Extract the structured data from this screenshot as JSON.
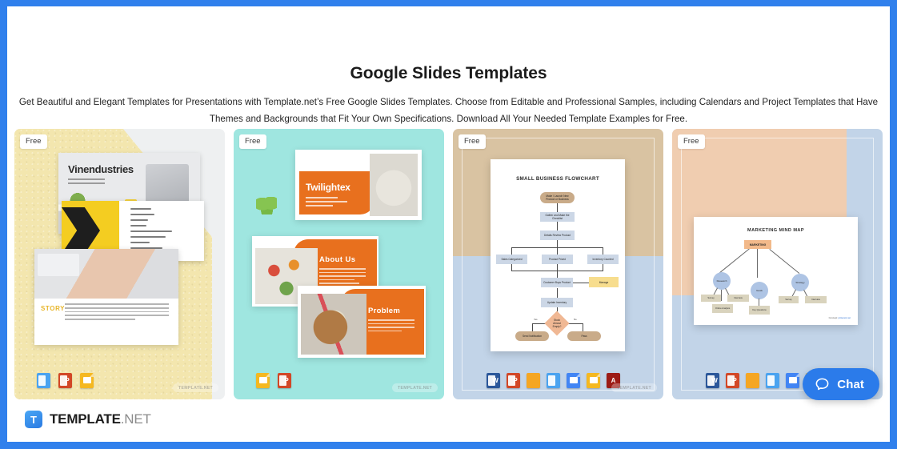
{
  "page": {
    "border_color": "#3080ec",
    "title": "Google Slides Templates",
    "subtitle": "Get Beautiful and Elegant Templates for Presentations with Template.net’s Free Google Slides Templates. Choose from Editable and Professional Samples, including Calendars and Project Templates that Have Themes and Backgrounds that Fit Your Own Specifications. Download All Your Needed Template Examples for Free."
  },
  "badges": {
    "free": "Free"
  },
  "watermark": "TEMPLATE.NET",
  "cards": [
    {
      "id": "vinendustries",
      "badge": "Free",
      "background": "#f3e6ae",
      "slide_title": "Vinendustries",
      "slide_story_label": "STORY",
      "formats": [
        "keynote",
        "powerpoint",
        "google-slides"
      ]
    },
    {
      "id": "twilightex",
      "badge": "Free",
      "background": "#9fe6e0",
      "slide_title": "Twilightex",
      "slide_about_title": "About Us",
      "slide_problem_title": "Problem",
      "formats": [
        "google-slides",
        "powerpoint"
      ]
    },
    {
      "id": "small-business-flowchart",
      "badge": "Free",
      "background_top": "#d9c3a2",
      "background_bottom": "#c2d4e8",
      "doc_title": "SMALL BUSINESS FLOWCHART",
      "formats": [
        "word",
        "powerpoint",
        "pages",
        "keynote",
        "google-docs",
        "google-slides",
        "pdf"
      ],
      "flowchart": {
        "nodes": [
          {
            "text": "Make / Launch New Product or Business",
            "type": "terminator"
          },
          {
            "text": "Gather and Make the Checklist",
            "type": "process"
          },
          {
            "text": "Details Review Product",
            "type": "process"
          },
          {
            "text": "Sales Categorized",
            "type": "process"
          },
          {
            "text": "Product Priced",
            "type": "process"
          },
          {
            "text": "Inventory Counted",
            "type": "process"
          },
          {
            "text": "Customer Buys Product",
            "type": "process"
          },
          {
            "text": "Manage",
            "type": "note"
          },
          {
            "text": "Update Inventory",
            "type": "process"
          },
          {
            "text": "Stock Almost Empty?",
            "type": "decision"
          },
          {
            "text": "Send Notification",
            "type": "terminator"
          },
          {
            "text": "Pass",
            "type": "terminator"
          }
        ],
        "decision_labels": [
          "Yes",
          "No"
        ]
      }
    },
    {
      "id": "marketing-mind-map",
      "badge": "Free",
      "background": "#c2d4e8",
      "background_accent": "#f0cdb0",
      "doc_title": "MARKETING MIND MAP",
      "formats": [
        "word",
        "powerpoint",
        "pages",
        "keynote",
        "google-docs",
        "google-slides"
      ],
      "mindmap": {
        "root": "MARKETING",
        "branches": [
          {
            "label": "Research",
            "children": [
              "Survey",
              "Interview",
              "Online Analysis"
            ]
          },
          {
            "label": "Goals",
            "children": [
              "Key Questions"
            ]
          },
          {
            "label": "Strategy",
            "children": [
              "Survey",
              "Interview"
            ]
          }
        ],
        "credit_prefix": "Concept:",
        "credit_link": "pinterest.net"
      }
    }
  ],
  "footer": {
    "logo_letter": "T",
    "logo_name": "TEMPLATE",
    "logo_domain": ".NET"
  },
  "chat": {
    "label": "Chat",
    "icon": "speech-bubble-icon",
    "color": "#2b7bea"
  }
}
